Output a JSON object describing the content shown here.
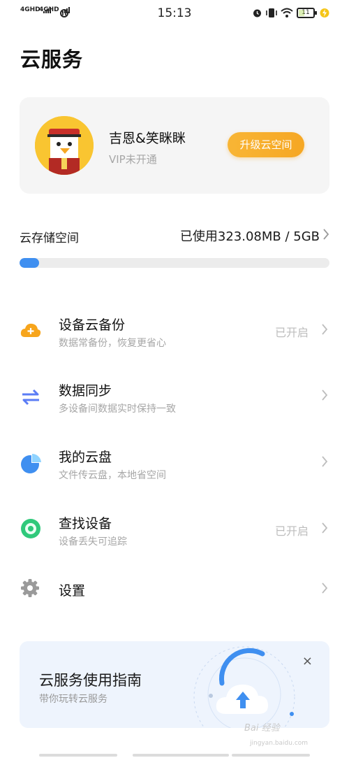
{
  "status_bar": {
    "sim1": "4GHD",
    "sim2": "4GHD",
    "time": "15:13",
    "battery": "11"
  },
  "page": {
    "title": "云服务"
  },
  "profile": {
    "name": "吉恩&笑眯眯",
    "vip_status": "VIP未开通",
    "upgrade_label": "升级云空间"
  },
  "storage": {
    "label": "云存储空间",
    "usage": "已使用323.08MB / 5GB",
    "used_fraction": 0.063
  },
  "menu": [
    {
      "title": "设备云备份",
      "subtitle": "数据常备份，恢复更省心",
      "status": "已开启",
      "icon": "cloud-backup-icon"
    },
    {
      "title": "数据同步",
      "subtitle": "多设备间数据实时保持一致",
      "status": "",
      "icon": "sync-arrows-icon"
    },
    {
      "title": "我的云盘",
      "subtitle": "文件传云盘，本地省空间",
      "status": "",
      "icon": "cloud-disk-pie-icon"
    },
    {
      "title": "查找设备",
      "subtitle": "设备丢失可追踪",
      "status": "已开启",
      "icon": "find-device-icon"
    },
    {
      "title": "设置",
      "subtitle": "",
      "status": "",
      "icon": "gear-icon"
    }
  ],
  "guide": {
    "title": "云服务使用指南",
    "subtitle": "带你玩转云服务",
    "close": "×"
  },
  "watermark": {
    "text": "Bai 经验",
    "sub": "jingyan.baidu.com"
  },
  "colors": {
    "accent_blue": "#3f8ff0",
    "upgrade_orange": "#f6a723",
    "backup_orange": "#f7a51c",
    "sync_blue": "#5b7cf5",
    "find_green": "#2fc97b"
  }
}
